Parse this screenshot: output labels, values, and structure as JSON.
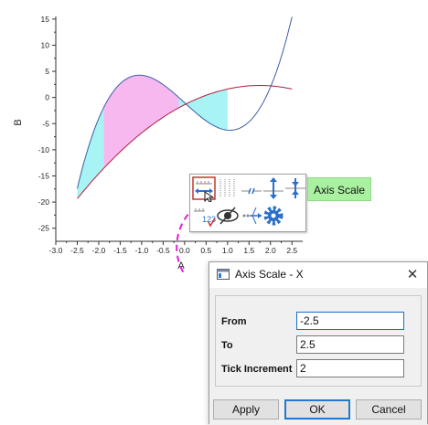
{
  "plot": {
    "ylabel": "B",
    "xlabel": "A",
    "x_ticks": [
      "-3.0",
      "-2.5",
      "-2.0",
      "-1.5",
      "-1.0",
      "-0.5",
      "0.0",
      "0.5",
      "1.0",
      "1.5",
      "2.0",
      "2.5"
    ],
    "y_ticks": [
      "15",
      "10",
      "5",
      "0",
      "-5",
      "-10",
      "-15",
      "-20",
      "-25"
    ],
    "colors": {
      "cubic_line": "#3b5fa8",
      "parabola_line": "#b01d3c",
      "fill_above": "#f7b8f0",
      "fill_below": "#a8f3f3",
      "connector": "#e020d8"
    }
  },
  "toolbar": {
    "buttons": [
      {
        "icon": "axis-scale-icon",
        "selected": true
      },
      {
        "icon": "grid-lines-icon"
      },
      {
        "icon": "axis-break-icon"
      },
      {
        "icon": "axis-extend-icon"
      },
      {
        "icon": "axis-reduce-icon"
      },
      {
        "icon": "tick-labels-icon"
      },
      {
        "icon": "visibility-icon"
      },
      {
        "icon": "axis-rescale-icon"
      },
      {
        "icon": "settings-gear-icon"
      }
    ],
    "tooltip": "Axis Scale"
  },
  "dialog": {
    "title": "Axis Scale - X",
    "close_label": "✕",
    "fields": {
      "from_label": "From",
      "from_value": "-2.5",
      "to_label": "To",
      "to_value": "2.5",
      "increment_label": "Tick Increment",
      "increment_value": "2"
    },
    "buttons": {
      "apply": "Apply",
      "ok": "OK",
      "cancel": "Cancel"
    }
  }
}
